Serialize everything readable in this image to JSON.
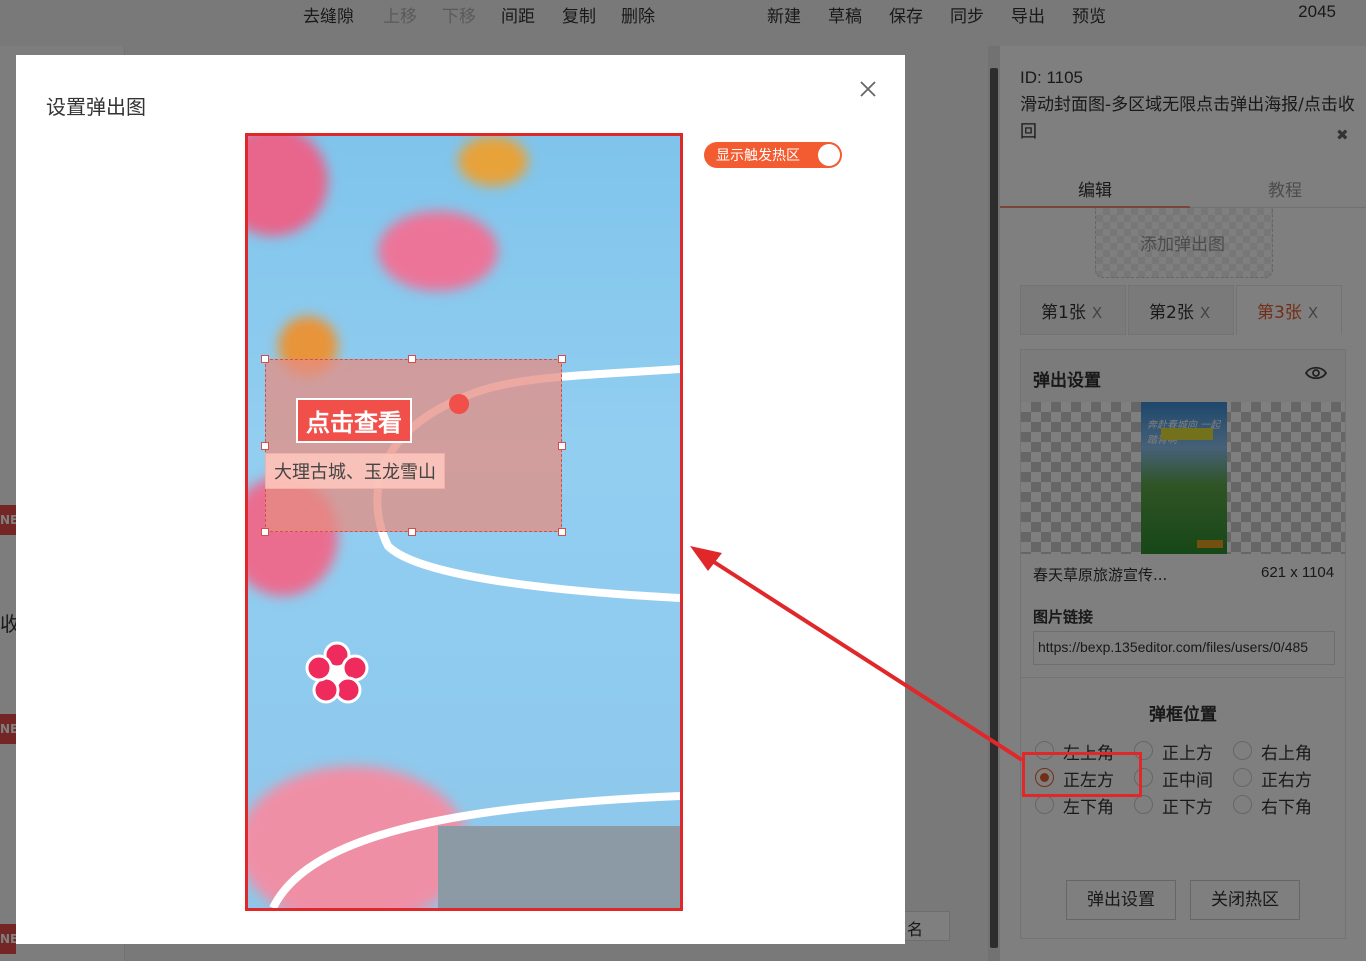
{
  "toolbar": {
    "items": [
      "去缝隙",
      "上移",
      "下移",
      "间距",
      "复制",
      "删除",
      "新建",
      "草稿",
      "保存",
      "同步",
      "导出",
      "预览"
    ],
    "count": "2045"
  },
  "background": {
    "new_badge": "NE",
    "left_text": "收",
    "bottom_input": "名"
  },
  "right_panel": {
    "id_label": "ID: 1105",
    "title": "滑动封面图-多区域无限点击弹出海报/点击收回",
    "tabs": [
      "编辑",
      "教程"
    ],
    "add_popup": "添加弹出图",
    "image_tabs": [
      {
        "label": "第1张",
        "close": "X"
      },
      {
        "label": "第2张",
        "close": "X"
      },
      {
        "label": "第3张",
        "close": "X"
      }
    ],
    "popup_settings_title": "弹出设置",
    "thumb_text": "奔赴春城向 一起踏青啊",
    "image_name": "春天草原旅游宣传...",
    "image_size": "621 x 1104",
    "link_label": "图片链接",
    "link_value": "https://bexp.135editor.com/files/users/0/485",
    "position_title": "弹框位置",
    "positions": [
      "左上角",
      "正上方",
      "右上角",
      "正左方",
      "正中间",
      "正右方",
      "左下角",
      "正下方",
      "右下角"
    ],
    "selected_position": "正左方",
    "buttons": [
      "弹出设置",
      "关闭热区"
    ]
  },
  "modal": {
    "title": "设置弹出图",
    "close": "X",
    "toggle_label": "显示触发热区",
    "toggle_on": true,
    "hotspot_button": "点击查看",
    "hotspot_subtitle": "大理古城、玉龙雪山"
  },
  "colors": {
    "accent": "#e65c2e",
    "toggle": "#f35b31",
    "annotation": "#e0272a"
  }
}
